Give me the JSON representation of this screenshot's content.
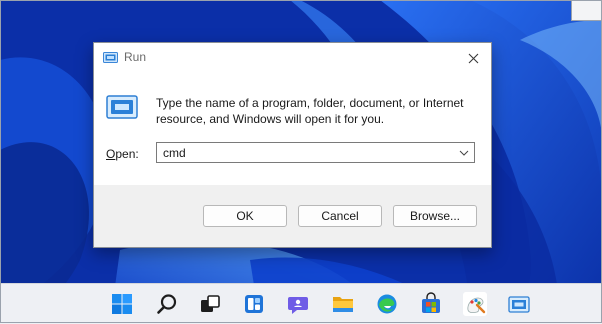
{
  "dialog": {
    "title": "Run",
    "icon": "run-icon",
    "description": "Type the name of a program, folder, document, or Internet resource, and Windows will open it for you.",
    "open_label_prefix": "O",
    "open_label_rest": "pen:",
    "open_value": "cmd",
    "buttons": {
      "ok": "OK",
      "cancel": "Cancel",
      "browse": "Browse..."
    }
  },
  "taskbar": {
    "icons": [
      "windows-start-icon",
      "search-icon",
      "task-view-icon",
      "widgets-icon",
      "chat-icon",
      "file-explorer-icon",
      "edge-icon",
      "microsoft-store-icon",
      "paint-icon",
      "run-icon"
    ]
  },
  "colors": {
    "accent": "#0067c0",
    "dialog_footer": "#f0f0f0",
    "taskbar": "#eef0f4"
  }
}
